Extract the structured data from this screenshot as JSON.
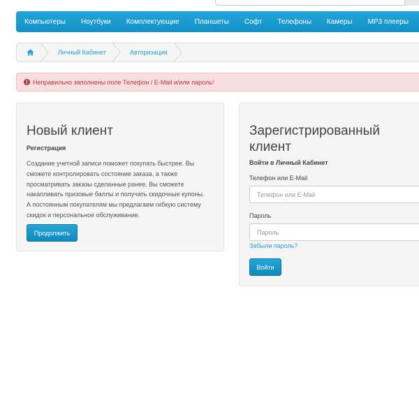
{
  "header": {
    "search_placeholder": ""
  },
  "menu": {
    "items": [
      {
        "label": "Компьютеры"
      },
      {
        "label": "Ноутбуки"
      },
      {
        "label": "Комплектующие"
      },
      {
        "label": "Планшеты"
      },
      {
        "label": "Софт"
      },
      {
        "label": "Телефоны"
      },
      {
        "label": "Камеры"
      },
      {
        "label": "MP3 плееры"
      }
    ],
    "last_icon": "map-icon",
    "color": "#1aa1d6"
  },
  "breadcrumb": {
    "home_icon": "home-icon",
    "items": [
      {
        "label": "Личный Кабинет"
      },
      {
        "label": "Авторизация"
      }
    ]
  },
  "alert": {
    "icon": "exclamation-circle-icon",
    "text": "Неправильно заполнены поле Телефон / E-Mail и/или пароль!",
    "color": "#b03b3b",
    "background": "#f8dede"
  },
  "new_customer": {
    "title": "Новый клиент",
    "subtitle": "Регистрация",
    "lines": [
      "Создание учетной записи поможет покупать быстрее. Вы",
      "сможете контролировать состояние заказа, а также",
      "просматривать заказы сделанные ранее. Вы сможете",
      "накапливать призовые баллы и получать скидочные купоны.",
      "А постоянным покупателям мы предлагаем гибкую систему",
      "скидок и персональное обслуживание."
    ],
    "button": "Продолжить"
  },
  "returning_customer": {
    "title_line1": "Зарегистрированный",
    "title_line2": "клиент",
    "subtitle": "Войти в Личный Кабинет",
    "login_label": "Телефон или E-Mail",
    "login_placeholder": "Телефон или E-Mail",
    "password_label": "Пароль",
    "password_placeholder": "Пароль",
    "forgot_link": "Забыли пароль?",
    "button": "Войти"
  }
}
